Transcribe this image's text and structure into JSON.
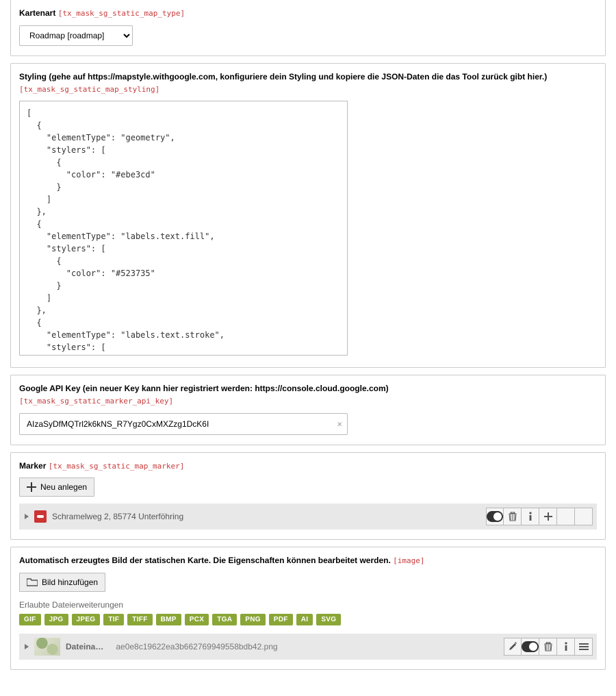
{
  "panel1": {
    "label": "Kartenart",
    "field": "[tx_mask_sg_static_map_type]",
    "select_value": "Roadmap [roadmap]"
  },
  "panel2": {
    "label": "Styling (gehe auf https://mapstyle.withgoogle.com, konfiguriere dein Styling und kopiere die JSON-Daten die das Tool zurück gibt hier.)",
    "field": "[tx_mask_sg_static_map_styling]",
    "textarea_value": "[\n  {\n    \"elementType\": \"geometry\",\n    \"stylers\": [\n      {\n        \"color\": \"#ebe3cd\"\n      }\n    ]\n  },\n  {\n    \"elementType\": \"labels.text.fill\",\n    \"stylers\": [\n      {\n        \"color\": \"#523735\"\n      }\n    ]\n  },\n  {\n    \"elementType\": \"labels.text.stroke\",\n    \"stylers\": [\n      {"
  },
  "panel3": {
    "label": "Google API Key (ein neuer Key kann hier registriert werden: https://console.cloud.google.com)",
    "field": "[tx_mask_sg_static_marker_api_key]",
    "input_value": "AIzaSyDfMQTrl2k6kNS_R7Ygz0CxMXZzg1DcK6I"
  },
  "panel4": {
    "label": "Marker",
    "field": "[tx_mask_sg_static_map_marker]",
    "btn_new": "Neu anlegen",
    "record_title": "Schramelweg 2, 85774 Unterföhring"
  },
  "panel5": {
    "label": "Automatisch erzeugtes Bild der statischen Karte. Die Eigenschaften können bearbeitet werden.",
    "field": "[image]",
    "btn_add": "Bild hinzufügen",
    "helper": "Erlaubte Dateierweiterungen",
    "extensions": [
      "GIF",
      "JPG",
      "JPEG",
      "TIF",
      "TIFF",
      "BMP",
      "PCX",
      "TGA",
      "PNG",
      "PDF",
      "AI",
      "SVG"
    ],
    "file_label": "Dateina…",
    "file_name": "ae0e8c19622ea3b662769949558bdb42.png"
  }
}
